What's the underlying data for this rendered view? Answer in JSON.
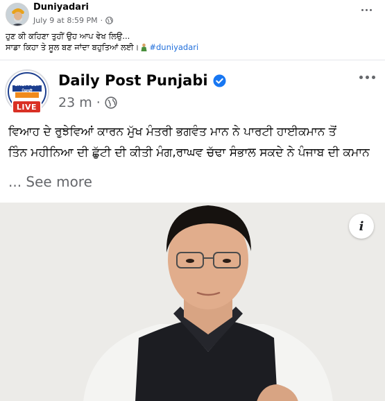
{
  "post": {
    "page_name": "Duniyadari",
    "timestamp": "July 9 at 8:59 PM",
    "separator": "·",
    "caption_line1": "ਹੁਣ ਕੀ ਕਹਿਣਾ ਤੁਹੀਂ ਉਹ ਆਪ ਵੇਖ ਲਿਉ...",
    "caption_line2": "ਸਾਡਾ ਕਿਹਾ ਤੇ ਸੂਲ ਬਣ ਜਾਂਦਾ ਬਹੁਤਿਆਂ ਲਈ।",
    "hashtag": "#duniyadari"
  },
  "shared_post": {
    "page_name": "Daily Post Punjabi",
    "logo_line1": "DAILY POST",
    "logo_line2": "ਪੰਜਾਬੀ",
    "live_label": "LIVE",
    "time_ago": "23 m",
    "separator": "·",
    "text_line1": "ਵਿਆਹ ਦੇ ਰੁਝੇਵਿਆਂ ਕਾਰਨ ਮੁੱਖ ਮੰਤਰੀ ਭਗਵੰਤ ਮਾਨ ਨੇ ਪਾਰਟੀ ਹਾਈਕਮਾਨ ਤੋਂ",
    "text_line2": "ਤਿੰਨ ਮਹੀਨਿਆ ਦੀ ਛੁੱਟੀ ਦੀ ਕੀਤੀ ਮੰਗ,ਰਾਘਵ ਚੱਢਾ ਸੰਭਾਲ ਸਕਦੇ ਨੇ ਪੰਜਾਬ ਦੀ ਕਮਾਨ",
    "see_more": "... See more",
    "info_label": "i"
  },
  "colors": {
    "link_blue": "#216fdb",
    "verified_blue": "#1877f2",
    "live_red": "#d93025",
    "meta_gray": "#65676b"
  },
  "icons": [
    "globe-icon",
    "verified-badge-icon",
    "more-options-icon",
    "info-icon",
    "emoji-icon"
  ]
}
